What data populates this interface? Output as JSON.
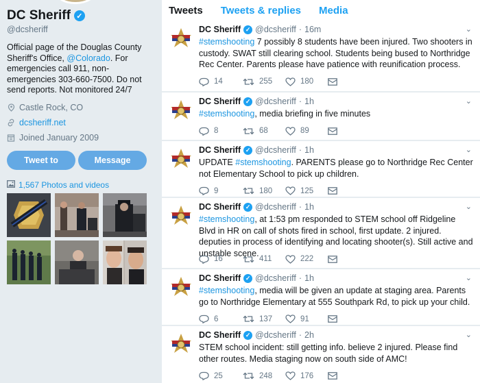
{
  "profile": {
    "name": "DC Sheriff",
    "handle": "@dcsheriff",
    "bio_before": "Official page of the Douglas County Sheriff's Office, ",
    "bio_link": "@Colorado",
    "bio_after": ". For emergencies call 911, non-emergencies 303-660-7500. Do not send reports. Not monitored 24/7",
    "location": "Castle Rock, CO",
    "website": "dcsheriff.net",
    "joined": "Joined January 2009",
    "tweet_to_label": "Tweet to",
    "message_label": "Message",
    "photos_label": "1,567 Photos and videos"
  },
  "tabs": [
    "Tweets",
    "Tweets & replies",
    "Media"
  ],
  "tweets": [
    {
      "name": "DC Sheriff",
      "handle": "@dcsheriff",
      "time": "16m",
      "hashtag": "#stemshooting",
      "text": " 7 possibly 8 students have been injured. Two shooters in custody. SWAT still clearing school. Students being bused to Northridge Rec Center. Parents please have patience with reunification process.",
      "replies": "14",
      "retweets": "255",
      "likes": "180"
    },
    {
      "name": "DC Sheriff",
      "handle": "@dcsheriff",
      "time": "1h",
      "hashtag": "#stemshooting",
      "text": ", media briefing in five minutes",
      "replies": "8",
      "retweets": "68",
      "likes": "89"
    },
    {
      "name": "DC Sheriff",
      "handle": "@dcsheriff",
      "time": "1h",
      "prefix": "UPDATE ",
      "hashtag": "#stemshooting",
      "text": ". PARENTS please go to Northridge Rec Center not Elementary School to pick up children.",
      "replies": "9",
      "retweets": "180",
      "likes": "125"
    },
    {
      "name": "DC Sheriff",
      "handle": "@dcsheriff",
      "time": "1h",
      "hashtag": "#stemshooting",
      "text": ", at 1:53 pm responded to STEM school off Ridgeline Blvd in HR on call of shots fired in school, first update. 2 injured. deputies in process of identifying and locating shooter(s). Still active and unstable scene.",
      "replies": "16",
      "retweets": "411",
      "likes": "222"
    },
    {
      "name": "DC Sheriff",
      "handle": "@dcsheriff",
      "time": "1h",
      "hashtag": "#stemshooting",
      "text": ", media will be given an update at staging area. Parents go to Northridge Elementary at 555 Southpark Rd, to pick up your child.",
      "replies": "6",
      "retweets": "137",
      "likes": "91"
    },
    {
      "name": "DC Sheriff",
      "handle": "@dcsheriff",
      "time": "2h",
      "text": "STEM school incident: still getting info. believe 2 injured. Please find other routes. Media staging now on south side of AMC!",
      "replies": "25",
      "retweets": "248",
      "likes": "176"
    }
  ],
  "icons": {
    "verified": "verified-badge-icon",
    "location": "map-pin-icon",
    "link": "link-icon",
    "calendar": "calendar-icon",
    "photos": "image-icon",
    "reply": "reply-icon",
    "retweet": "retweet-icon",
    "like": "heart-icon",
    "dm": "envelope-icon",
    "caret": "chevron-down-icon"
  },
  "colors": {
    "accent": "#1da1f2",
    "link": "#1b95e0",
    "button": "#64a9e4",
    "page_bg": "#e6ecf0",
    "muted": "#657786"
  }
}
